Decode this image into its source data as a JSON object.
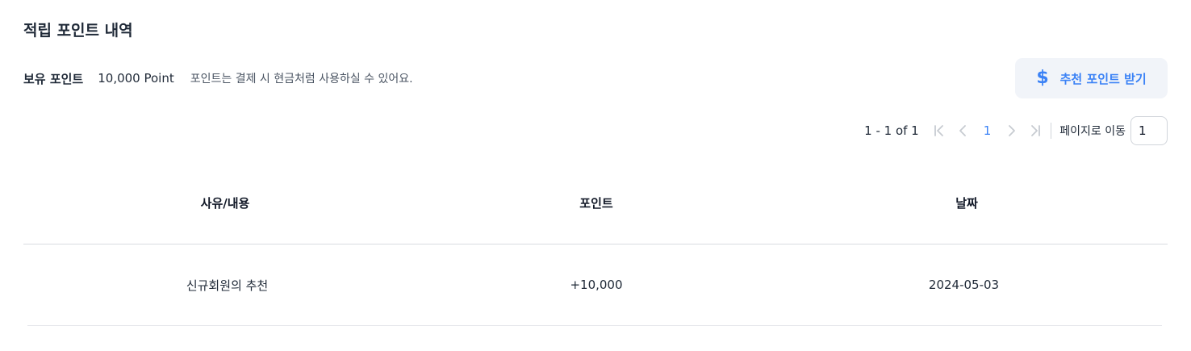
{
  "page": {
    "title": "적립 포인트 내역"
  },
  "summary": {
    "label": "보유 포인트",
    "value": "10,000 Point",
    "note": "포인트는 결제 시 현금처럼 사용하실 수 있어요."
  },
  "recommend_button": {
    "icon": "dollar-icon",
    "icon_glyph": "$",
    "label": "추천 포인트 받기",
    "color": "#3b82f6"
  },
  "pagination": {
    "range": "1 - 1 of 1",
    "current_page": "1",
    "goto_label": "페이지로 이동",
    "goto_value": "1"
  },
  "table": {
    "columns": [
      "사유/내용",
      "포인트",
      "날짜"
    ],
    "rows": [
      {
        "reason": "신규회원의 추천",
        "points": "+10,000",
        "date": "2024-05-03"
      }
    ]
  }
}
